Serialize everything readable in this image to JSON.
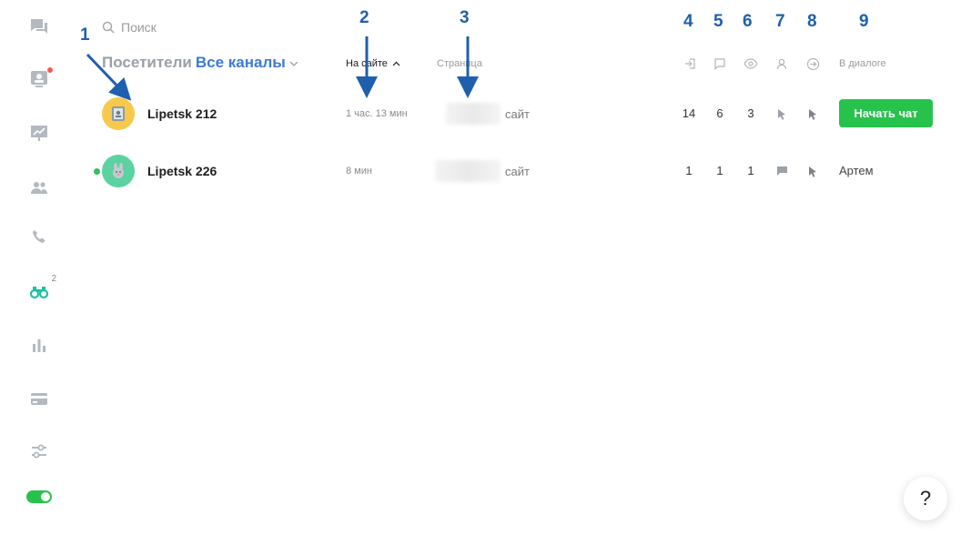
{
  "sidebar": {
    "items": [
      {
        "name": "chats",
        "icon": "chat-bubbles-icon"
      },
      {
        "name": "visitors-board",
        "icon": "contact-card-icon",
        "has_dot": true
      },
      {
        "name": "presentation",
        "icon": "presentation-chart-icon"
      },
      {
        "name": "team",
        "icon": "people-icon"
      },
      {
        "name": "calls",
        "icon": "phone-icon"
      },
      {
        "name": "monitoring",
        "icon": "binoculars-icon",
        "badge": "2",
        "active": true
      },
      {
        "name": "statistics",
        "icon": "bar-chart-icon"
      },
      {
        "name": "billing",
        "icon": "credit-card-icon"
      },
      {
        "name": "settings",
        "icon": "sliders-icon"
      }
    ],
    "toggle_on": true
  },
  "search": {
    "placeholder": "Поиск"
  },
  "header": {
    "title": "Посетители",
    "channel": "Все каналы",
    "columns": {
      "on_site": "На сайте",
      "page": "Страница",
      "in_dialog": "В диалоге"
    }
  },
  "annotations": [
    "1",
    "2",
    "3",
    "4",
    "5",
    "6",
    "7",
    "8",
    "9"
  ],
  "visitors": [
    {
      "name": "Lipetsk 212",
      "time_on_site": "1 час. 13 мин",
      "page": "сайт",
      "visits": "14",
      "chats": "6",
      "views": "3",
      "online": false,
      "avatar_color": "#f7c94b",
      "action_label": "Начать чат"
    },
    {
      "name": "Lipetsk 226",
      "time_on_site": "8 мин",
      "page": "сайт",
      "visits": "1",
      "chats": "1",
      "views": "1",
      "online": true,
      "avatar_color": "#5bd2a0",
      "operator": "Артем"
    }
  ],
  "help": {
    "label": "?"
  },
  "colors": {
    "accent_blue": "#3b7bd4",
    "accent_green": "#27c24c",
    "annotation_blue": "#1f5fae",
    "status_red": "#f25c54"
  }
}
